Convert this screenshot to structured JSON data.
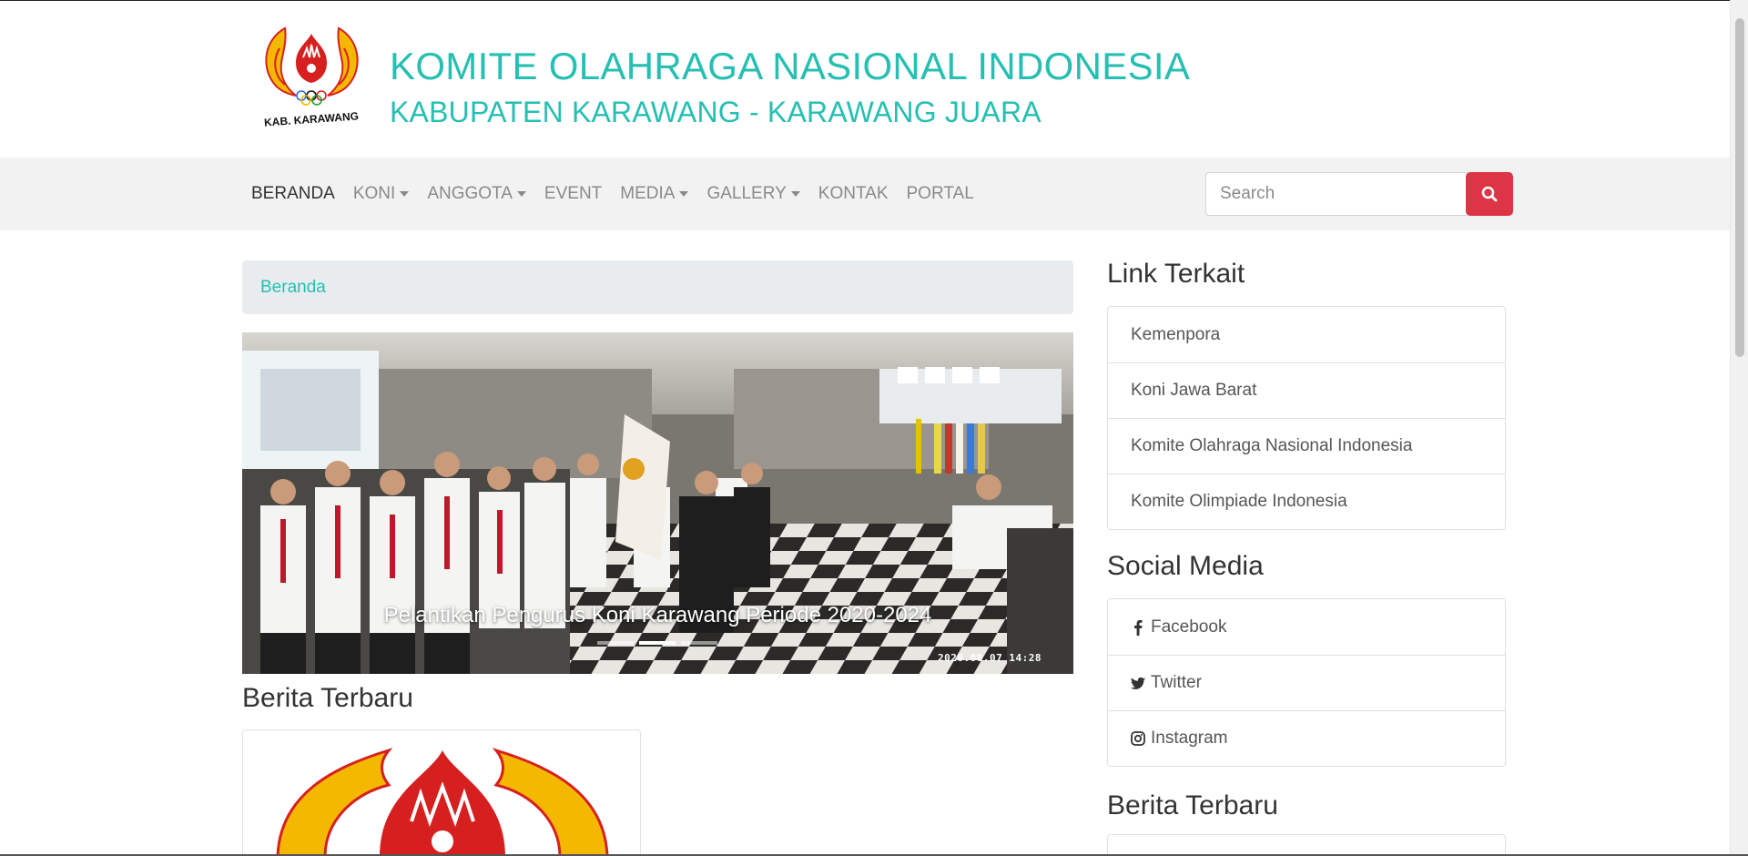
{
  "header": {
    "title": "KOMITE OLAHRAGA NASIONAL INDONESIA",
    "subtitle": "KABUPATEN KARAWANG - KARAWANG JUARA",
    "logo_text": "KAB. KARAWANG"
  },
  "nav": {
    "items": [
      {
        "label": "BERANDA",
        "dropdown": false,
        "active": true
      },
      {
        "label": "KONI",
        "dropdown": true
      },
      {
        "label": "ANGGOTA",
        "dropdown": true
      },
      {
        "label": "EVENT",
        "dropdown": false
      },
      {
        "label": "MEDIA",
        "dropdown": true
      },
      {
        "label": "GALLERY",
        "dropdown": true
      },
      {
        "label": "KONTAK",
        "dropdown": false
      },
      {
        "label": "PORTAL",
        "dropdown": false
      }
    ],
    "search_placeholder": "Search",
    "search_icon": "search-icon"
  },
  "breadcrumb": {
    "current": "Beranda"
  },
  "carousel": {
    "caption": "Pelantikan Pengurus Koni Karawang Periode 2020-2024",
    "timestamp": "2020.08.07 14:28",
    "slides": 3,
    "active_slide": 1
  },
  "main": {
    "news_heading": "Berita Terbaru"
  },
  "sidebar": {
    "links_heading": "Link Terkait",
    "links": [
      "Kemenpora",
      "Koni Jawa Barat",
      "Komite Olahraga Nasional Indonesia",
      "Komite Olimpiade Indonesia"
    ],
    "social_heading": "Social Media",
    "social": [
      {
        "label": "Facebook",
        "icon": "facebook-icon"
      },
      {
        "label": "Twitter",
        "icon": "twitter-icon"
      },
      {
        "label": "Instagram",
        "icon": "instagram-icon"
      }
    ],
    "news_heading": "Berita Terbaru"
  },
  "colors": {
    "accent": "#26bfb2",
    "search_button": "#dc3545",
    "navbar_bg": "#f2f2f3",
    "breadcrumb_bg": "#e9ecef"
  }
}
